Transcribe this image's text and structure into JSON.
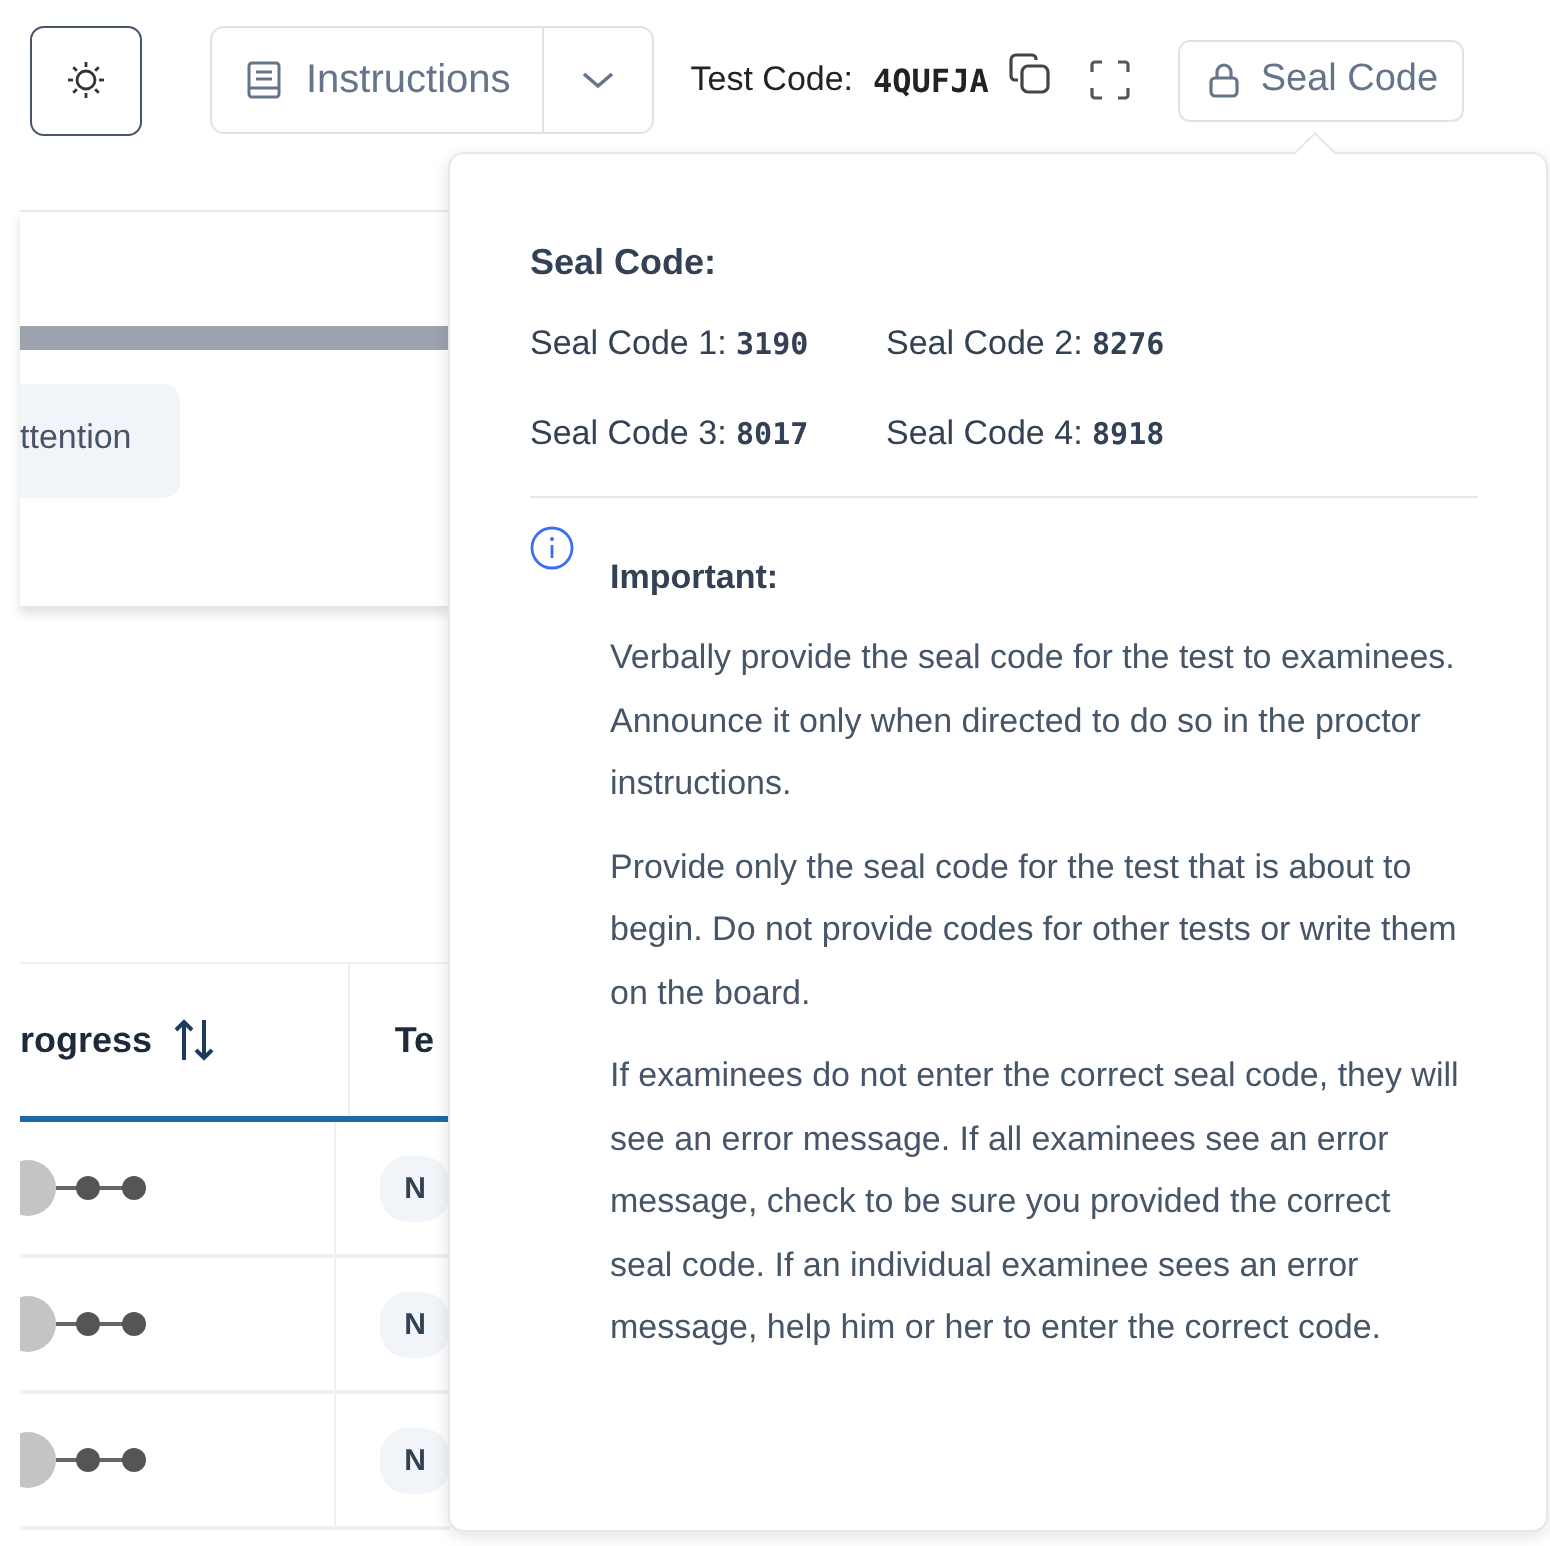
{
  "toolbar": {
    "instructions_button": {
      "label": "Instructions"
    },
    "test_code": {
      "label": "Test Code:",
      "value": "4QUFJA"
    },
    "seal_code_button": {
      "label": "Seal Code"
    }
  },
  "card": {
    "chip": "ttention"
  },
  "table": {
    "columns": [
      {
        "label": "rogress",
        "kind": "sortable"
      },
      {
        "label": "Te",
        "kind": "plain"
      }
    ],
    "rows": [
      {
        "column_2": "N"
      },
      {
        "column_2": "N"
      },
      {
        "column_2": "N"
      }
    ]
  },
  "popover": {
    "title": "Seal Code:",
    "codes": [
      {
        "label": "Seal Code 1:",
        "value": "3190"
      },
      {
        "label": "Seal Code 2:",
        "value": "8276"
      },
      {
        "label": "Seal Code 3:",
        "value": "8017"
      },
      {
        "label": "Seal Code 4:",
        "value": "8918"
      }
    ],
    "notice": {
      "title": "Important:",
      "paragraphs": [
        "Verbally provide the seal code for the test to examinees. Announce it only when directed to do so in the proctor instructions.",
        "Provide only the seal code for the test that is about to begin. Do not provide codes for other tests or write them on the board.",
        "If examinees do not enter the correct seal code, they will see an error message. If all examinees see an error message, check to be sure you provided the correct seal code. If an individual examinee sees an error message, help him or her to enter the correct code."
      ]
    }
  }
}
